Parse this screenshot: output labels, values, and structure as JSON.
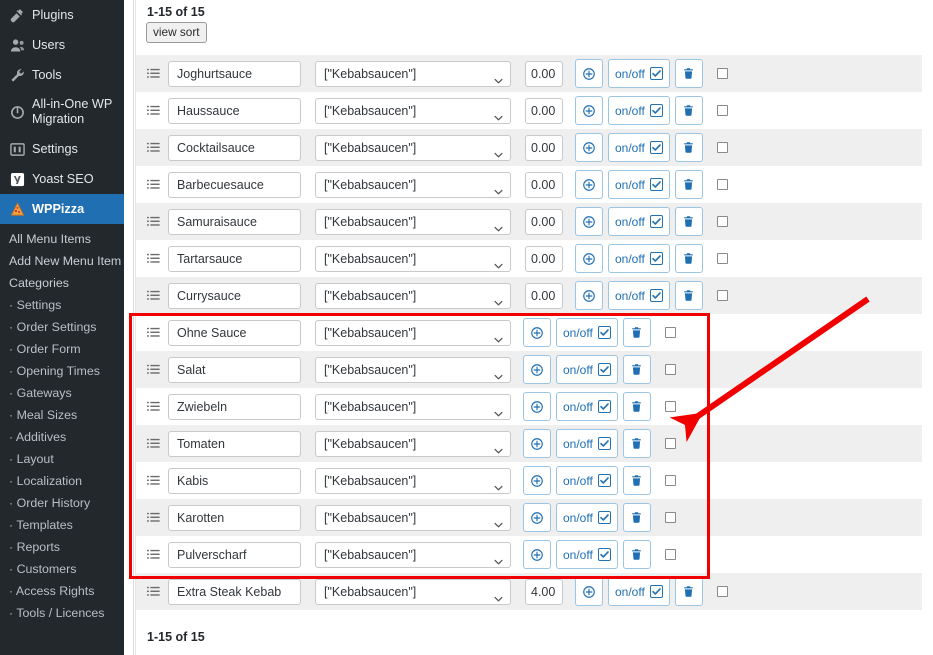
{
  "sidebar": {
    "menu": [
      {
        "label": "Plugins",
        "icon": "plugin-icon",
        "active": false
      },
      {
        "label": "Users",
        "icon": "users-icon",
        "active": false
      },
      {
        "label": "Tools",
        "icon": "wrench-icon",
        "active": false
      },
      {
        "label": "All-in-One WP Migration",
        "icon": "migration-icon",
        "active": false
      },
      {
        "label": "Settings",
        "icon": "settings-icon",
        "active": false
      },
      {
        "label": "Yoast SEO",
        "icon": "yoast-icon",
        "active": false
      },
      {
        "label": "WPPizza",
        "icon": "pizza-icon",
        "active": true
      }
    ],
    "submenu": [
      {
        "label": "All Menu Items",
        "top": true
      },
      {
        "label": "Add New Menu Item",
        "top": true
      },
      {
        "label": "Categories",
        "top": true
      },
      {
        "label": "· Settings",
        "top": false
      },
      {
        "label": "· Order Settings",
        "top": false
      },
      {
        "label": "· Order Form",
        "top": false
      },
      {
        "label": "· Opening Times",
        "top": false
      },
      {
        "label": "· Gateways",
        "top": false
      },
      {
        "label": "· Meal Sizes",
        "top": false
      },
      {
        "label": "· Additives",
        "top": false
      },
      {
        "label": "· Layout",
        "top": false
      },
      {
        "label": "· Localization",
        "top": false
      },
      {
        "label": "· Order History",
        "top": false
      },
      {
        "label": "· Templates",
        "top": false
      },
      {
        "label": "· Reports",
        "top": false
      },
      {
        "label": "· Customers",
        "top": false
      },
      {
        "label": "· Access Rights",
        "top": false
      },
      {
        "label": "· Tools / Licences",
        "top": false
      }
    ],
    "accent_color": "#1f6fb2",
    "background_color": "#23282d"
  },
  "toolbar": {
    "count_top": "1-15 of 15",
    "count_bottom": "1-15 of 15",
    "view_sort_label": "view sort"
  },
  "row_controls": {
    "add_label": "add",
    "onoff_label": "on/off",
    "delete_label": "delete",
    "select_chevron": "chevron-down-icon"
  },
  "rows": [
    {
      "name": "Joghurtsauce",
      "category": "[\"Kebabsaucen\"]",
      "price": "0.00",
      "has_price": true,
      "enabled": true,
      "selected": false,
      "highlighted": false
    },
    {
      "name": "Haussauce",
      "category": "[\"Kebabsaucen\"]",
      "price": "0.00",
      "has_price": true,
      "enabled": true,
      "selected": false,
      "highlighted": false
    },
    {
      "name": "Cocktailsauce",
      "category": "[\"Kebabsaucen\"]",
      "price": "0.00",
      "has_price": true,
      "enabled": true,
      "selected": false,
      "highlighted": false
    },
    {
      "name": "Barbecuesauce",
      "category": "[\"Kebabsaucen\"]",
      "price": "0.00",
      "has_price": true,
      "enabled": true,
      "selected": false,
      "highlighted": false
    },
    {
      "name": "Samuraisauce",
      "category": "[\"Kebabsaucen\"]",
      "price": "0.00",
      "has_price": true,
      "enabled": true,
      "selected": false,
      "highlighted": false
    },
    {
      "name": "Tartarsauce",
      "category": "[\"Kebabsaucen\"]",
      "price": "0.00",
      "has_price": true,
      "enabled": true,
      "selected": false,
      "highlighted": false
    },
    {
      "name": "Currysauce",
      "category": "[\"Kebabsaucen\"]",
      "price": "0.00",
      "has_price": true,
      "enabled": true,
      "selected": false,
      "highlighted": false
    },
    {
      "name": "Ohne Sauce",
      "category": "[\"Kebabsaucen\"]",
      "price": "",
      "has_price": false,
      "enabled": true,
      "selected": false,
      "highlighted": true
    },
    {
      "name": "Salat",
      "category": "[\"Kebabsaucen\"]",
      "price": "",
      "has_price": false,
      "enabled": true,
      "selected": false,
      "highlighted": true
    },
    {
      "name": "Zwiebeln",
      "category": "[\"Kebabsaucen\"]",
      "price": "",
      "has_price": false,
      "enabled": true,
      "selected": false,
      "highlighted": true
    },
    {
      "name": "Tomaten",
      "category": "[\"Kebabsaucen\"]",
      "price": "",
      "has_price": false,
      "enabled": true,
      "selected": false,
      "highlighted": true
    },
    {
      "name": "Kabis",
      "category": "[\"Kebabsaucen\"]",
      "price": "",
      "has_price": false,
      "enabled": true,
      "selected": false,
      "highlighted": true
    },
    {
      "name": "Karotten",
      "category": "[\"Kebabsaucen\"]",
      "price": "",
      "has_price": false,
      "enabled": true,
      "selected": false,
      "highlighted": true
    },
    {
      "name": "Pulverscharf",
      "category": "[\"Kebabsaucen\"]",
      "price": "",
      "has_price": false,
      "enabled": true,
      "selected": false,
      "highlighted": true
    },
    {
      "name": "Extra Steak Kebab",
      "category": "[\"Kebabsaucen\"]",
      "price": "4.00",
      "has_price": true,
      "enabled": true,
      "selected": false,
      "highlighted": false
    }
  ],
  "annotations": {
    "highlight_color": "#f10000",
    "box_note": "red rectangle around rows 8-14",
    "arrow_note": "red arrow pointing to highlighted rows"
  }
}
